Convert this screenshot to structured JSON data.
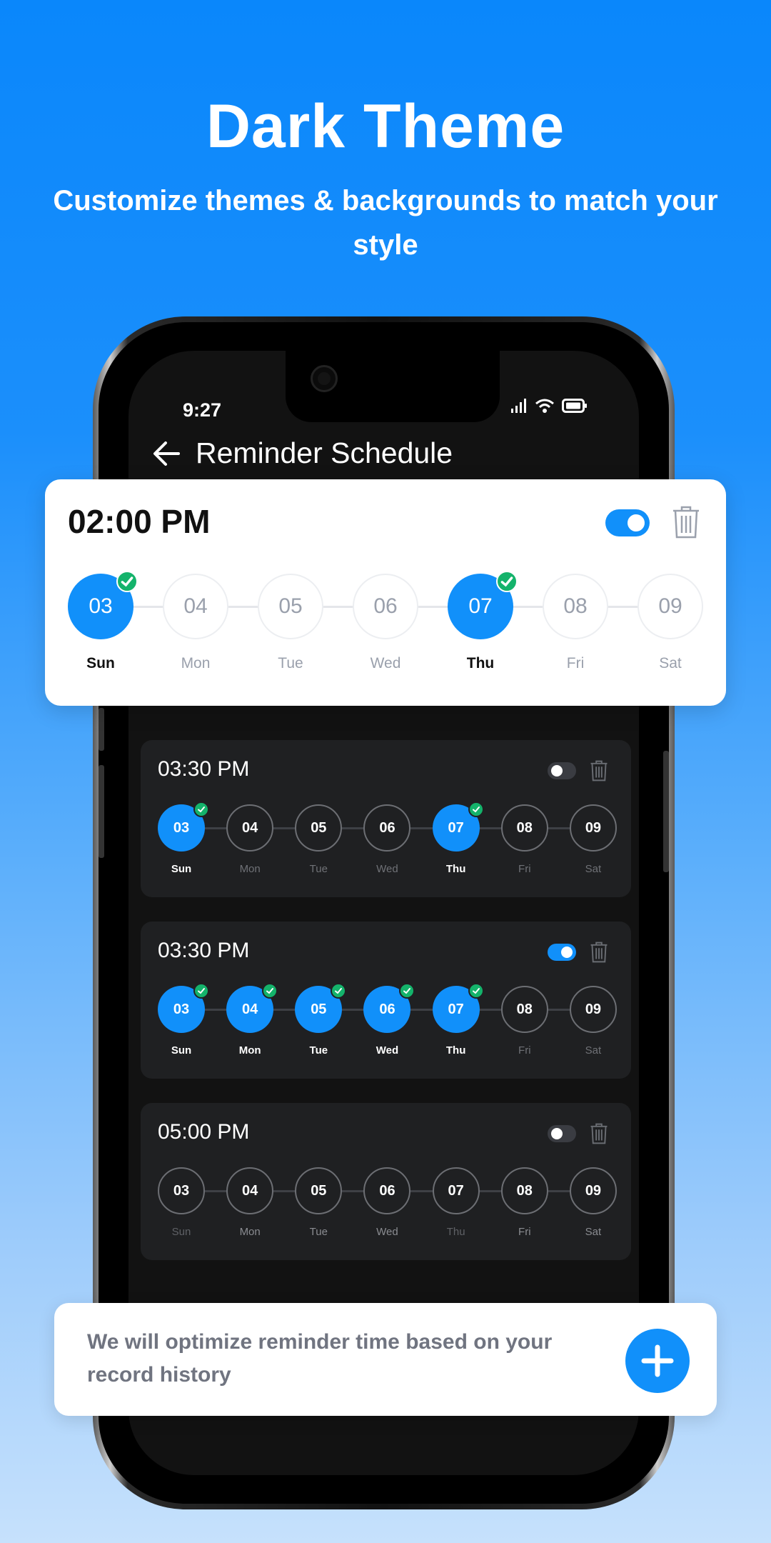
{
  "hero": {
    "title": "Dark Theme",
    "subtitle": "Customize themes & backgrounds to match your style"
  },
  "status_bar": {
    "time": "9:27",
    "icons": [
      "signal-icon",
      "wifi-icon",
      "battery-icon"
    ]
  },
  "header": {
    "back_icon": "arrow-left-icon",
    "title": "Reminder Schedule"
  },
  "colors": {
    "accent": "#1190fa",
    "check": "#14b36b",
    "dark_card": "#1f2022"
  },
  "reminders": [
    {
      "time": "02:00 PM",
      "enabled": true,
      "highlighted": true,
      "days": [
        {
          "date": "03",
          "label": "Sun",
          "selected": true
        },
        {
          "date": "04",
          "label": "Mon",
          "selected": false
        },
        {
          "date": "05",
          "label": "Tue",
          "selected": false
        },
        {
          "date": "06",
          "label": "Wed",
          "selected": false
        },
        {
          "date": "07",
          "label": "Thu",
          "selected": true
        },
        {
          "date": "08",
          "label": "Fri",
          "selected": false
        },
        {
          "date": "09",
          "label": "Sat",
          "selected": false
        }
      ]
    },
    {
      "time": "03:30 PM",
      "enabled": false,
      "days": [
        {
          "date": "03",
          "label": "Sun",
          "selected": true
        },
        {
          "date": "04",
          "label": "Mon",
          "selected": false
        },
        {
          "date": "05",
          "label": "Tue",
          "selected": false
        },
        {
          "date": "06",
          "label": "Wed",
          "selected": false
        },
        {
          "date": "07",
          "label": "Thu",
          "selected": true
        },
        {
          "date": "08",
          "label": "Fri",
          "selected": false
        },
        {
          "date": "09",
          "label": "Sat",
          "selected": false
        }
      ]
    },
    {
      "time": "03:30 PM",
      "enabled": true,
      "days": [
        {
          "date": "03",
          "label": "Sun",
          "selected": true
        },
        {
          "date": "04",
          "label": "Mon",
          "selected": true
        },
        {
          "date": "05",
          "label": "Tue",
          "selected": true
        },
        {
          "date": "06",
          "label": "Wed",
          "selected": true
        },
        {
          "date": "07",
          "label": "Thu",
          "selected": true
        },
        {
          "date": "08",
          "label": "Fri",
          "selected": false
        },
        {
          "date": "09",
          "label": "Sat",
          "selected": false
        }
      ]
    },
    {
      "time": "05:00 PM",
      "enabled": false,
      "days": [
        {
          "date": "03",
          "label": "Sun",
          "selected": false
        },
        {
          "date": "04",
          "label": "Mon",
          "selected": false
        },
        {
          "date": "05",
          "label": "Tue",
          "selected": false
        },
        {
          "date": "06",
          "label": "Wed",
          "selected": false
        },
        {
          "date": "07",
          "label": "Thu",
          "selected": false
        },
        {
          "date": "08",
          "label": "Fri",
          "selected": false
        },
        {
          "date": "09",
          "label": "Sat",
          "selected": false
        }
      ]
    }
  ],
  "banner": {
    "text": "We will optimize reminder time based on your record history",
    "add_icon": "plus-icon"
  }
}
